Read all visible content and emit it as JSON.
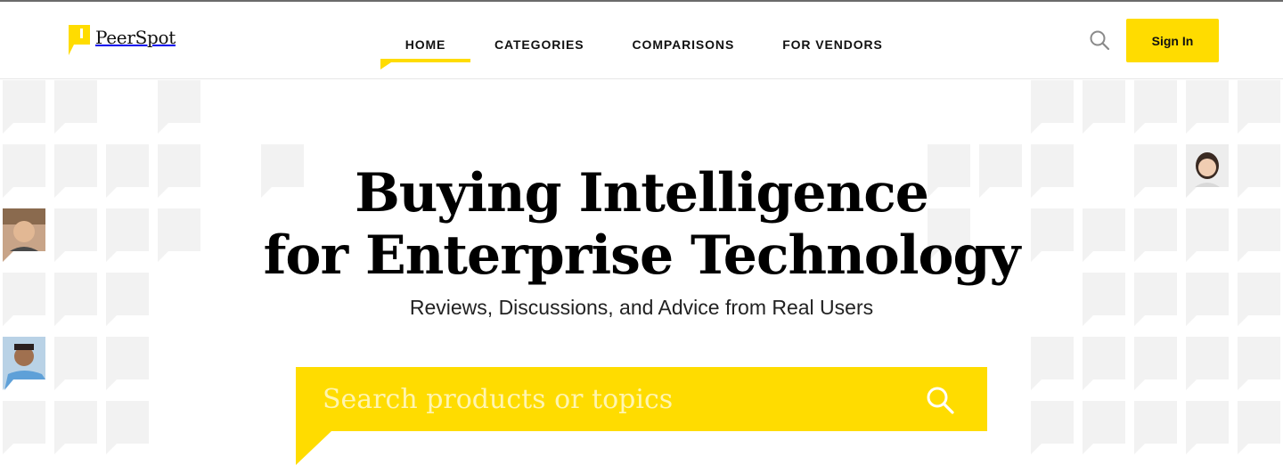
{
  "brand": {
    "name": "PeerSpot",
    "accent_color": "#ffdc00"
  },
  "nav": {
    "items": [
      {
        "label": "HOME",
        "active": true
      },
      {
        "label": "CATEGORIES",
        "active": false
      },
      {
        "label": "COMPARISONS",
        "active": false
      },
      {
        "label": "FOR VENDORS",
        "active": false
      }
    ]
  },
  "header": {
    "search_icon": "search-icon",
    "sign_in_label": "Sign In"
  },
  "hero": {
    "headline_line1": "Buying Intelligence",
    "headline_line2": "for Enterprise Technology",
    "subheadline": "Reviews, Discussions, and Advice from Real Users",
    "search_placeholder": "Search products or topics",
    "search_icon": "search-icon",
    "avatars": [
      "user-avatar-woman",
      "user-avatar-man",
      "user-avatar-woman-2"
    ]
  }
}
